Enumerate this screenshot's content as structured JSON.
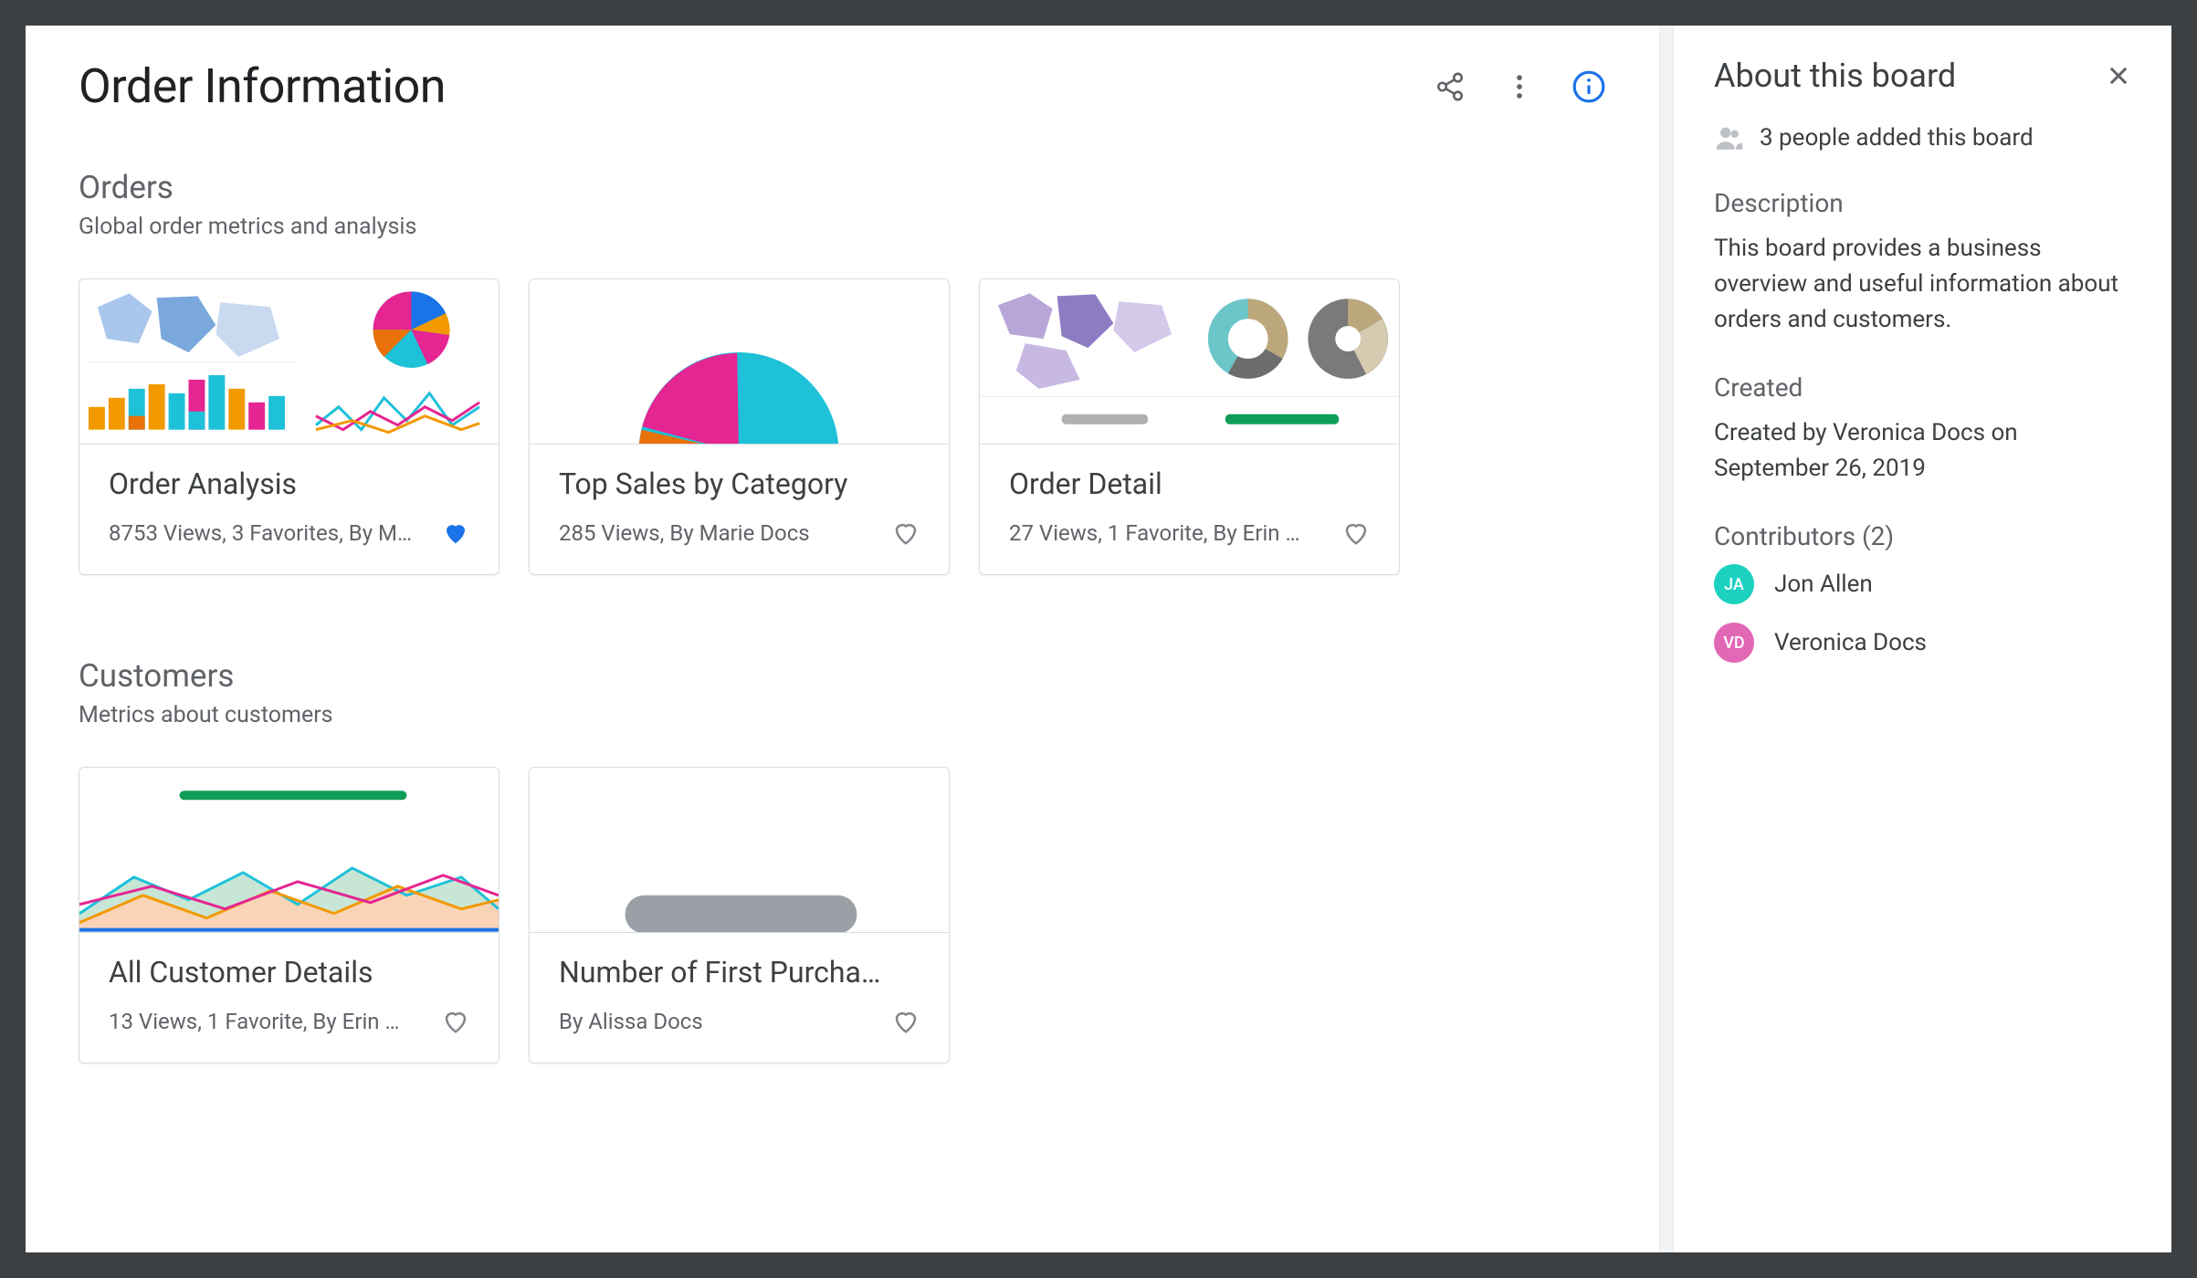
{
  "page": {
    "title": "Order Information"
  },
  "sections": [
    {
      "title": "Orders",
      "subtitle": "Global order metrics and analysis",
      "cards": [
        {
          "title": "Order Analysis",
          "meta": "8753 Views, 3 Favorites, By M…",
          "favorited": true
        },
        {
          "title": "Top Sales by Category",
          "meta": "285 Views, By Marie Docs",
          "favorited": false
        },
        {
          "title": "Order Detail",
          "meta": "27 Views, 1 Favorite, By Erin …",
          "favorited": false
        }
      ]
    },
    {
      "title": "Customers",
      "subtitle": "Metrics about customers",
      "cards": [
        {
          "title": "All Customer Details",
          "meta": "13 Views, 1 Favorite, By Erin …",
          "favorited": false
        },
        {
          "title": "Number of First Purcha…",
          "meta": "By Alissa Docs",
          "favorited": false
        }
      ]
    }
  ],
  "info": {
    "title": "About this board",
    "people_added": "3 people added this board",
    "description_label": "Description",
    "description_text": "This board provides a business overview and useful information about orders and customers.",
    "created_label": "Created",
    "created_text": "Created by Veronica Docs on September 26, 2019",
    "contributors_label": "Contributors (2)",
    "contributors": [
      {
        "initials": "JA",
        "name": "Jon Allen",
        "cls": "ja"
      },
      {
        "initials": "VD",
        "name": "Veronica Docs",
        "cls": "vd"
      }
    ]
  }
}
